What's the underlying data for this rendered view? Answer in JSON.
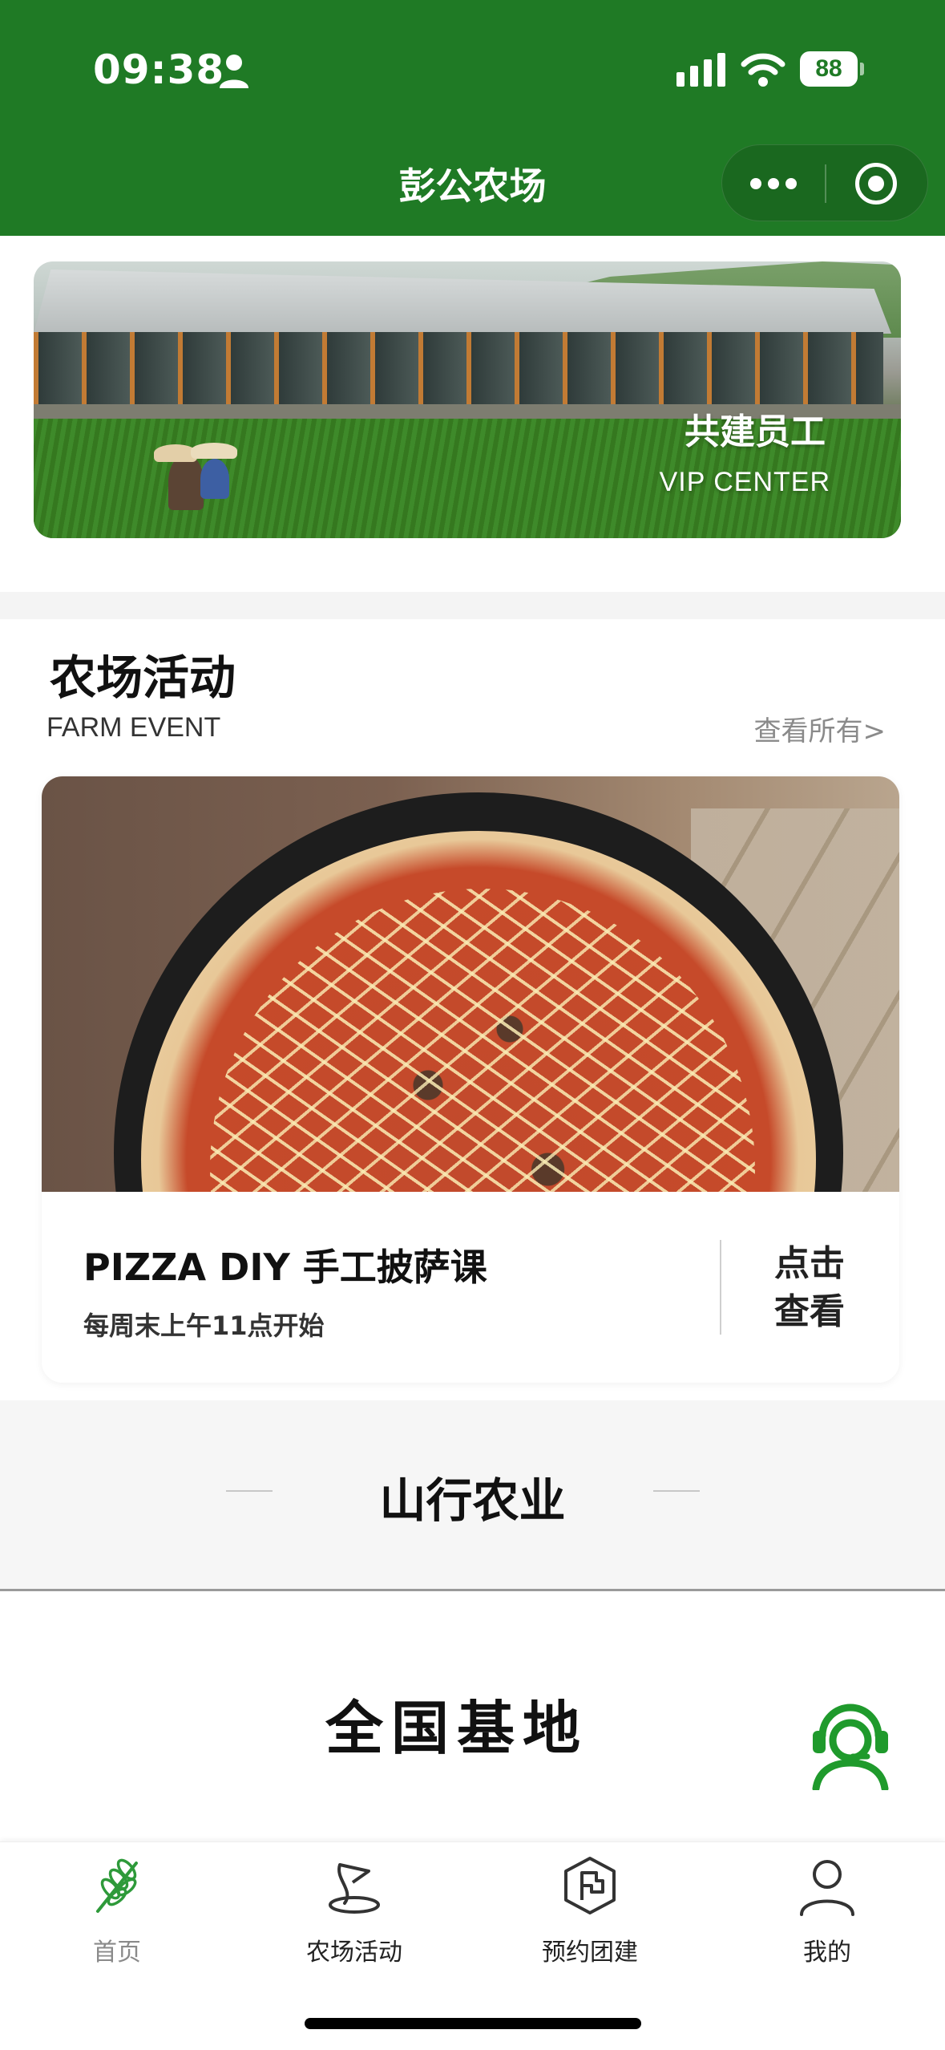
{
  "status_bar": {
    "time": "09:38",
    "battery": "88"
  },
  "header": {
    "title": "彭公农场"
  },
  "banner": {
    "title": "共建员工",
    "subtitle": "VIP CENTER"
  },
  "farm_event": {
    "title": "农场活动",
    "subtitle": "FARM EVENT",
    "view_all": "查看所有>",
    "card": {
      "title": "PIZZA DIY 手工披萨课",
      "time": "每周末上午11点开始",
      "cta_line1": "点击",
      "cta_line2": "查看"
    }
  },
  "band": {
    "title": "山行农业"
  },
  "bases": {
    "title": "全国基地"
  },
  "tabs": [
    {
      "label": "首页",
      "icon": "wheat-icon",
      "active": true
    },
    {
      "label": "农场活动",
      "icon": "golf-flag-icon",
      "active": false
    },
    {
      "label": "预约团建",
      "icon": "hexagon-flag-icon",
      "active": false
    },
    {
      "label": "我的",
      "icon": "user-icon",
      "active": false
    }
  ],
  "colors": {
    "brand_green": "#1f7a25",
    "tab_active_icon": "#2e9a3a",
    "muted_text": "#8a8a8a"
  }
}
